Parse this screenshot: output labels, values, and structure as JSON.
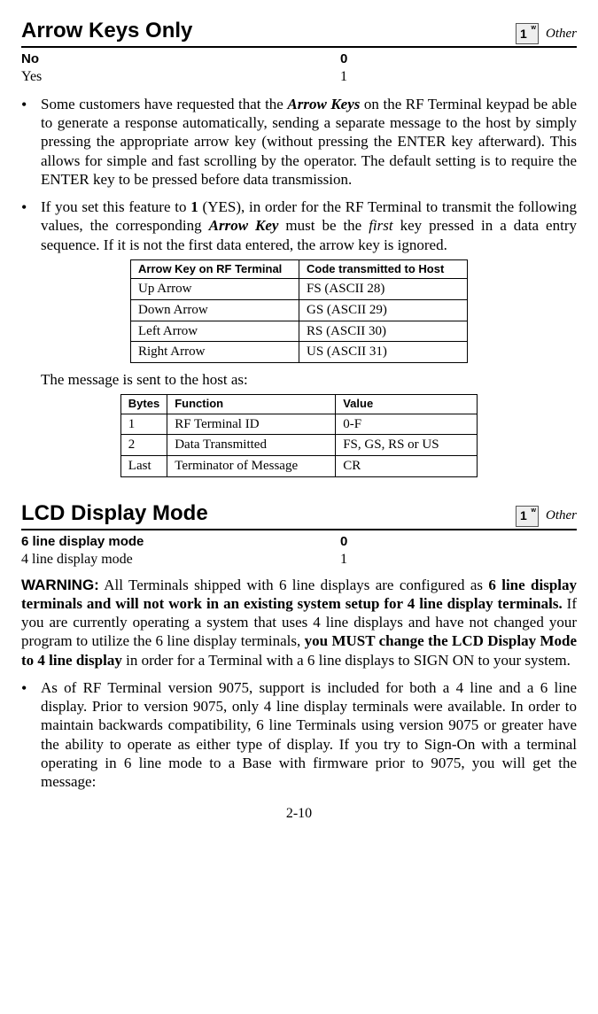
{
  "section1": {
    "title": "Arrow Keys Only",
    "tag": "Other",
    "keyglyph": "1",
    "options": [
      {
        "label": "No",
        "value": "0",
        "bold": true
      },
      {
        "label": "Yes",
        "value": "1",
        "bold": false
      }
    ],
    "bullet1": {
      "pre": "Some customers have requested that the ",
      "em1": "Arrow Keys",
      "post": " on the RF Terminal keypad be able to generate a response automatically, sending a separate message to the host by simply pressing the appropriate arrow key (without pressing the ENTER key afterward). This allows for simple and fast scrolling by the operator.  The default setting is to require the ENTER key to be pressed before data transmission."
    },
    "bullet2": {
      "pre": "If you set this feature to ",
      "b1": "1",
      "mid1": " (YES), in order for the RF Terminal to transmit the following values, the corresponding ",
      "em1": "Arrow Key",
      "mid2": " must be the ",
      "it1": "first",
      "post": " key pressed in a data entry sequence. If it is not the first data entered, the arrow key is ignored."
    },
    "table1": {
      "headers": [
        "Arrow Key on RF Terminal",
        "Code transmitted to Host"
      ],
      "rows": [
        [
          "Up Arrow",
          "FS (ASCII 28)"
        ],
        [
          "Down Arrow",
          "GS (ASCII 29)"
        ],
        [
          "Left Arrow",
          "RS (ASCII 30)"
        ],
        [
          "Right Arrow",
          "US (ASCII 31)"
        ]
      ]
    },
    "msg_line": "The message is sent to the host as:",
    "table2": {
      "headers": [
        "Bytes",
        "Function",
        "Value"
      ],
      "rows": [
        [
          "1",
          "RF Terminal ID",
          "0-F"
        ],
        [
          "2",
          "Data Transmitted",
          "FS, GS, RS or US"
        ],
        [
          "Last",
          "Terminator of Message",
          "CR"
        ]
      ]
    }
  },
  "section2": {
    "title": "LCD Display Mode",
    "tag": "Other",
    "keyglyph": "1",
    "options": [
      {
        "label": "6 line display mode",
        "value": "0",
        "bold": true
      },
      {
        "label": "4 line display mode",
        "value": "1",
        "bold": false
      }
    ],
    "warning": {
      "label": "WARNING:",
      "p1": "  All Terminals shipped with 6 line displays are configured as ",
      "b1": "6 line display terminals and will not work in an existing system setup for 4 line display terminals.",
      "p2": "  If you are currently operating a system that uses 4 line displays and have not changed your program to utilize the 6 line display terminals, ",
      "b2": "you MUST change the LCD Display Mode to 4 line display",
      "p3": " in order for a Terminal with a 6 line displays to SIGN ON to your system."
    },
    "bullet1": "As of RF Terminal version 9075, support is included for both a 4 line and a 6 line display. Prior to version 9075, only 4 line display terminals were available. In order to maintain backwards compatibility, 6 line Terminals using version 9075 or greater have the ability to operate as either type of display.  If you try to Sign-On with a terminal operating in 6 line mode to a Base with firmware prior to 9075, you will get the message:"
  },
  "page": "2-10"
}
